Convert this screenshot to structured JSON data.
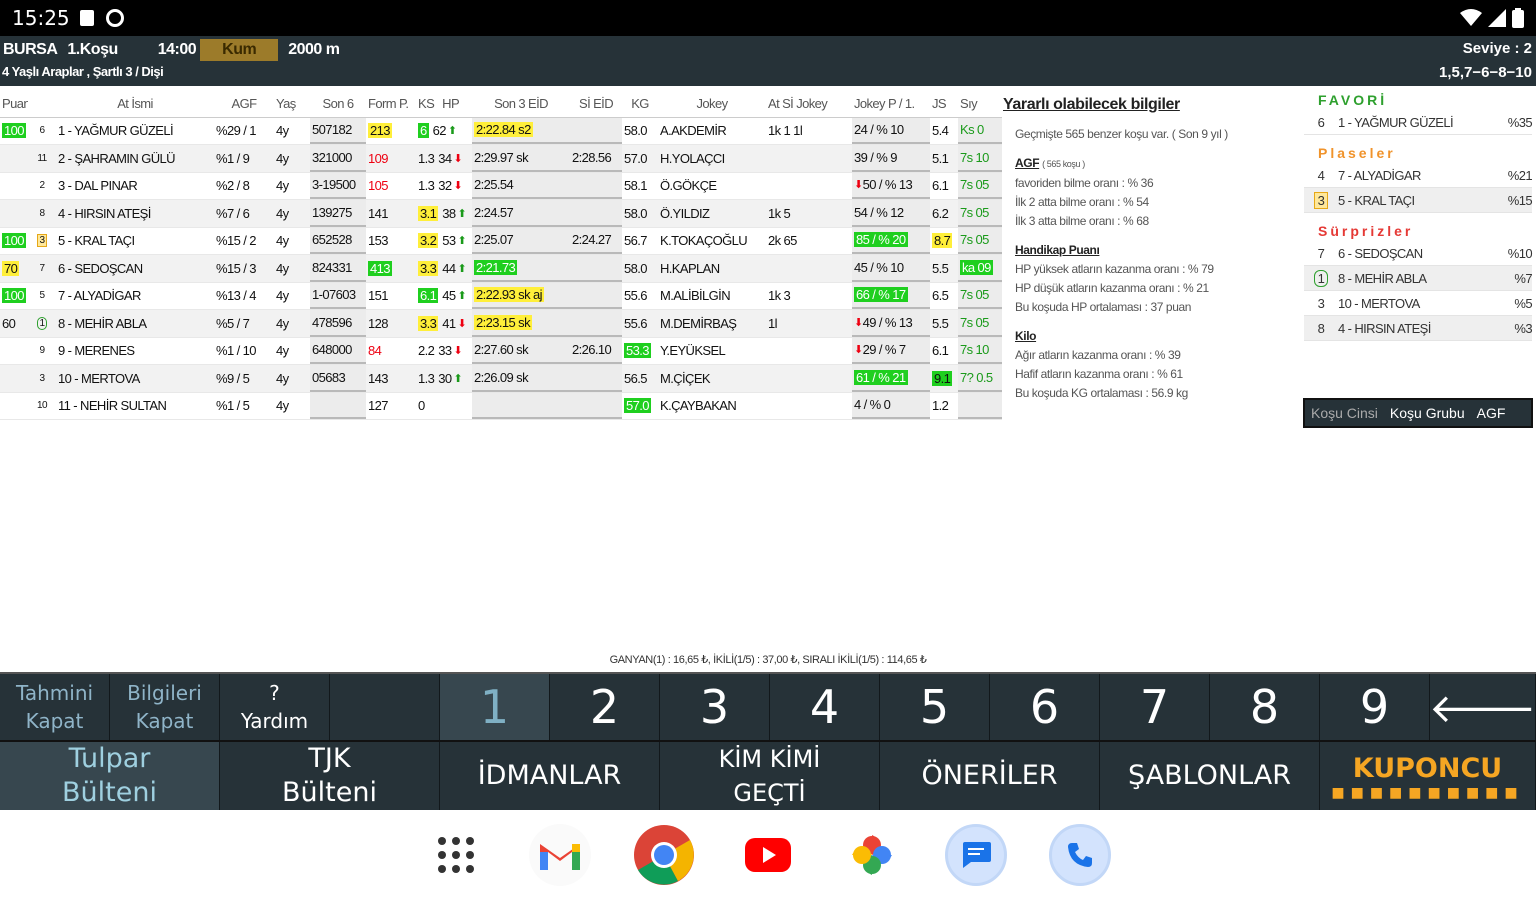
{
  "status": {
    "time": "15:25"
  },
  "header": {
    "track": "BURSA",
    "race": "1.Koşu",
    "time": "14:00",
    "surface": "Kum",
    "distance": "2000 m",
    "subtitle": "4 Yaşlı Araplar , Şartlı 3 / Dişi",
    "level": "Seviye : 2",
    "prediction": "1,5,7−6−8−10"
  },
  "table": {
    "headers": [
      "Puan",
      "",
      "At İsmi",
      "AGF",
      "Yaş",
      "Son 6",
      "Form P.",
      "KS",
      "HP",
      "Son 3 EİD",
      "Sİ EİD",
      "KG",
      "Jokey",
      "At Sİ Jokey",
      "Jokey P / 1.",
      "JS",
      "Sıy"
    ],
    "rows": [
      {
        "puan": "100",
        "no": "6",
        "name": "1 - YAĞMUR GÜZELİ",
        "agf": "%29 / 1",
        "yas": "4y",
        "son6": "507182",
        "form": "213",
        "ks": "6",
        "hp": "62",
        "arrow": "up",
        "eid": "2:22.84 s2",
        "sieid": "",
        "kg": "58.0",
        "jokey": "A.AKDEMİR",
        "atsi": "1k 1 1l",
        "jp": "24 / % 10",
        "js": "5.4",
        "siy": "Ks 0"
      },
      {
        "puan": "",
        "no": "11",
        "name": "2 - ŞAHRAMIN GÜLÜ",
        "agf": "%1 / 9",
        "yas": "4y",
        "son6": "321000",
        "form": "109",
        "ks": "1.3",
        "hp": "34",
        "arrow": "down",
        "eid": "2:29.97 sk",
        "sieid": "2:28.56",
        "kg": "57.0",
        "jokey": "H.YOLAÇCI",
        "atsi": "",
        "jp": "39 / % 9",
        "js": "5.1",
        "siy": "7s 10"
      },
      {
        "puan": "",
        "no": "2",
        "name": "3 - DAL PINAR",
        "agf": "%2 / 8",
        "yas": "4y",
        "son6": "3-19500",
        "form": "105",
        "ks": "1.3",
        "hp": "32",
        "arrow": "down",
        "eid": "2:25.54",
        "sieid": "",
        "kg": "58.1",
        "jokey": "Ö.GÖKÇE",
        "atsi": "",
        "jp": "50 / % 13",
        "js": "6.1",
        "siy": "7s 05"
      },
      {
        "puan": "",
        "no": "8",
        "name": "4 - HIRSIN ATEŞİ",
        "agf": "%7 / 6",
        "yas": "4y",
        "son6": "139275",
        "form": "141",
        "ks": "3.1",
        "hp": "38",
        "arrow": "up",
        "eid": "2:24.57",
        "sieid": "",
        "kg": "58.0",
        "jokey": "Ö.YILDIZ",
        "atsi": "1k 5",
        "jp": "54 / % 12",
        "js": "6.2",
        "siy": "7s 05"
      },
      {
        "puan": "100",
        "no": "3",
        "name": "5 - KRAL TAÇI",
        "agf": "%15 / 2",
        "yas": "4y",
        "son6": "652528",
        "form": "153",
        "ks": "3.2",
        "hp": "53",
        "arrow": "up",
        "eid": "2:25.07",
        "sieid": "2:24.27",
        "kg": "56.7",
        "jokey": "K.TOKAÇOĞLU",
        "atsi": "2k 65",
        "jp": "85 / % 20",
        "js": "8.7",
        "siy": "7s 05"
      },
      {
        "puan": "70",
        "no": "7",
        "name": "6 - SEDOŞCAN",
        "agf": "%15 / 3",
        "yas": "4y",
        "son6": "824331",
        "form": "413",
        "ks": "3.3",
        "hp": "44",
        "arrow": "up",
        "eid": "2:21.73",
        "sieid": "",
        "kg": "58.0",
        "jokey": "H.KAPLAN",
        "atsi": "",
        "jp": "45 / % 10",
        "js": "5.5",
        "siy": "ka 09"
      },
      {
        "puan": "100",
        "no": "5",
        "name": "7 - ALYADİGAR",
        "agf": "%13 / 4",
        "yas": "4y",
        "son6": "1-07603",
        "form": "151",
        "ks": "6.1",
        "hp": "45",
        "arrow": "up",
        "eid": "2:22.93 sk aj",
        "sieid": "",
        "kg": "55.6",
        "jokey": "M.ALİBİLGİN",
        "atsi": "1k 3",
        "jp": "66 / % 17",
        "js": "6.5",
        "siy": "7s 05"
      },
      {
        "puan": "60",
        "no": "1",
        "name": "8 - MEHİR ABLA",
        "agf": "%5 / 7",
        "yas": "4y",
        "son6": "478596",
        "form": "128",
        "ks": "3.3",
        "hp": "41",
        "arrow": "down",
        "eid": "2:23.15 sk",
        "sieid": "",
        "kg": "55.6",
        "jokey": "M.DEMİRBAŞ",
        "atsi": "1l",
        "jp": "49 / % 13",
        "js": "5.5",
        "siy": "7s 05"
      },
      {
        "puan": "",
        "no": "9",
        "name": "9 - MERENES",
        "agf": "%1 / 10",
        "yas": "4y",
        "son6": "648000",
        "form": "84",
        "ks": "2.2",
        "hp": "33",
        "arrow": "down",
        "eid": "2:27.60 sk",
        "sieid": "2:26.10",
        "kg": "53.3",
        "jokey": "Y.EYÜKSEL",
        "atsi": "",
        "jp": "29 / % 7",
        "js": "6.1",
        "siy": "7s 10"
      },
      {
        "puan": "",
        "no": "3",
        "name": "10 - MERTOVA",
        "agf": "%9 / 5",
        "yas": "4y",
        "son6": "05683",
        "form": "143",
        "ks": "1.3",
        "hp": "30",
        "arrow": "up",
        "eid": "2:26.09 sk",
        "sieid": "",
        "kg": "56.5",
        "jokey": "M.ÇİÇEK",
        "atsi": "",
        "jp": "61 / % 21",
        "js": "9.1",
        "siy": "7? 0.5"
      },
      {
        "puan": "",
        "no": "10",
        "name": "11 - NEHİR SULTAN",
        "agf": "%1 / 5",
        "yas": "4y",
        "son6": "",
        "form": "127",
        "ks": "0",
        "hp": "",
        "arrow": "",
        "eid": "",
        "sieid": "",
        "kg": "57.0",
        "jokey": "K.ÇAYBAKAN",
        "atsi": "",
        "jp": "4 / % 0",
        "js": "1.2",
        "siy": ""
      }
    ]
  },
  "info": {
    "title": "Yararlı olabilecek bilgiler",
    "intro": "Geçmişte 565 benzer koşu var. ( Son 9 yıl )",
    "agf_title": "AGF",
    "agf_small": "( 565 koşu )",
    "agf_lines": [
      "favoriden bilme oranı : % 36",
      "İlk 2 atta bilme oranı : % 54",
      "İlk 3 atta bilme oranı : % 68"
    ],
    "hp_title": "Handikap Puanı",
    "hp_lines": [
      "HP yüksek atların kazanma oranı : % 79",
      "HP düşük atların kazanma oranı : % 21",
      "Bu koşuda HP ortalaması : 37 puan"
    ],
    "kilo_title": "Kilo",
    "kilo_lines": [
      "Ağır atların kazanma oranı : % 39",
      "Hafif atların kazanma oranı : % 61",
      "Bu koşuda KG ortalaması : 56.9 kg"
    ]
  },
  "side": {
    "fav_title": "FAVORİ",
    "fav": [
      {
        "no": "6",
        "name": "1 - YAĞMUR GÜZELİ",
        "pct": "%35"
      }
    ],
    "plase_title": "Plaseler",
    "plase": [
      {
        "no": "4",
        "name": "7 - ALYADİGAR",
        "pct": "%21"
      },
      {
        "no": "3",
        "name": "5 - KRAL TAÇI",
        "pct": "%15"
      }
    ],
    "surpriz_title": "Sürprizler",
    "surpriz": [
      {
        "no": "7",
        "name": "6 - SEDOŞCAN",
        "pct": "%10"
      },
      {
        "no": "1",
        "name": "8 - MEHİR ABLA",
        "pct": "%7"
      },
      {
        "no": "3",
        "name": "10 - MERTOVA",
        "pct": "%5"
      },
      {
        "no": "8",
        "name": "4 - HIRSIN ATEŞİ",
        "pct": "%3"
      }
    ],
    "btn1": "Koşu Cinsi",
    "btn2": "Koşu Grubu",
    "btn3": "AGF"
  },
  "footnote": "GANYAN(1) : 16,65 ₺, İKİLİ(1/5) : 37,00 ₺, SIRALI İKİLİ(1/5) : 114,65 ₺",
  "numbar": {
    "c1a": "Tahmini",
    "c1b": "Kapat",
    "c2a": "Bilgileri",
    "c2b": "Kapat",
    "c3a": "?",
    "c3b": "Yardım",
    "nums": [
      "1",
      "2",
      "3",
      "4",
      "5",
      "6",
      "7",
      "8",
      "9"
    ],
    "back": "🡐"
  },
  "tabs": {
    "t1a": "Tulpar",
    "t1b": "Bülteni",
    "t2a": "TJK",
    "t2b": "Bülteni",
    "t3": "İDMANLAR",
    "t4a": "KİM KİMİ",
    "t4b": "GEÇTİ",
    "t5": "ÖNERİLER",
    "t6": "ŞABLONLAR",
    "t7": "KUPONCU"
  }
}
